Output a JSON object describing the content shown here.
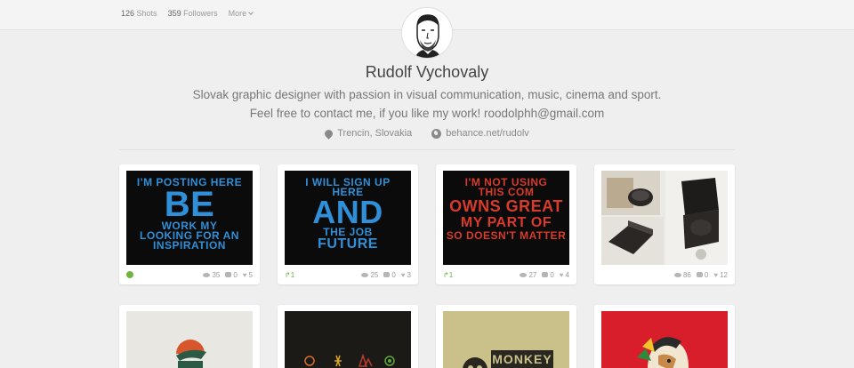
{
  "topbar": {
    "shots_count": "126",
    "shots_label": "Shots",
    "followers_count": "359",
    "followers_label": "Followers",
    "more_label": "More"
  },
  "profile": {
    "name": "Rudolf Vychovaly",
    "bio": "Slovak graphic designer with passion in visual communication, music, cinema and sport. Feel free to contact me, if you like my work! roodolphh@gmail.com",
    "location": "Trencin, Slovakia",
    "website": "behance.net/rudolv"
  },
  "shots": [
    {
      "lines": [
        "I'M POSTING HERE",
        "BE",
        "WORK MY",
        "LOOKING FOR AN",
        "INSPIRATION"
      ],
      "text_color": "#2f8fd8",
      "bg": "#0b0b0b",
      "rebounds": "",
      "views": "35",
      "comments": "0",
      "likes": "5"
    },
    {
      "lines": [
        "I WILL SIGN UP",
        "HERE",
        "AND",
        "THE JOB",
        "FUTURE"
      ],
      "text_color": "#2f8fd8",
      "bg": "#0b0b0b",
      "rebounds": "1",
      "views": "25",
      "comments": "0",
      "likes": "3"
    },
    {
      "lines": [
        "I'M NOT USING",
        "THIS COM",
        "OWNS GREAT",
        "MY PART OF",
        "SO DOESN'T MATTER"
      ],
      "text_color": "#d83a2b",
      "bg": "#0b0b0b",
      "rebounds": "1",
      "views": "27",
      "comments": "0",
      "likes": "4"
    },
    {
      "lines": [],
      "text_color": "#333",
      "bg": "#e9e6e0",
      "rebounds": "",
      "views": "86",
      "comments": "0",
      "likes": "12"
    }
  ],
  "row2_shots": [
    {
      "bg": "#e9e7e2"
    },
    {
      "bg": "#1c1a17"
    },
    {
      "bg": "#c9c08a",
      "label": "MONKEY"
    },
    {
      "bg": "#d81e2a"
    }
  ],
  "colors": {
    "accent_green": "#6fb43c",
    "background": "#efefef"
  }
}
